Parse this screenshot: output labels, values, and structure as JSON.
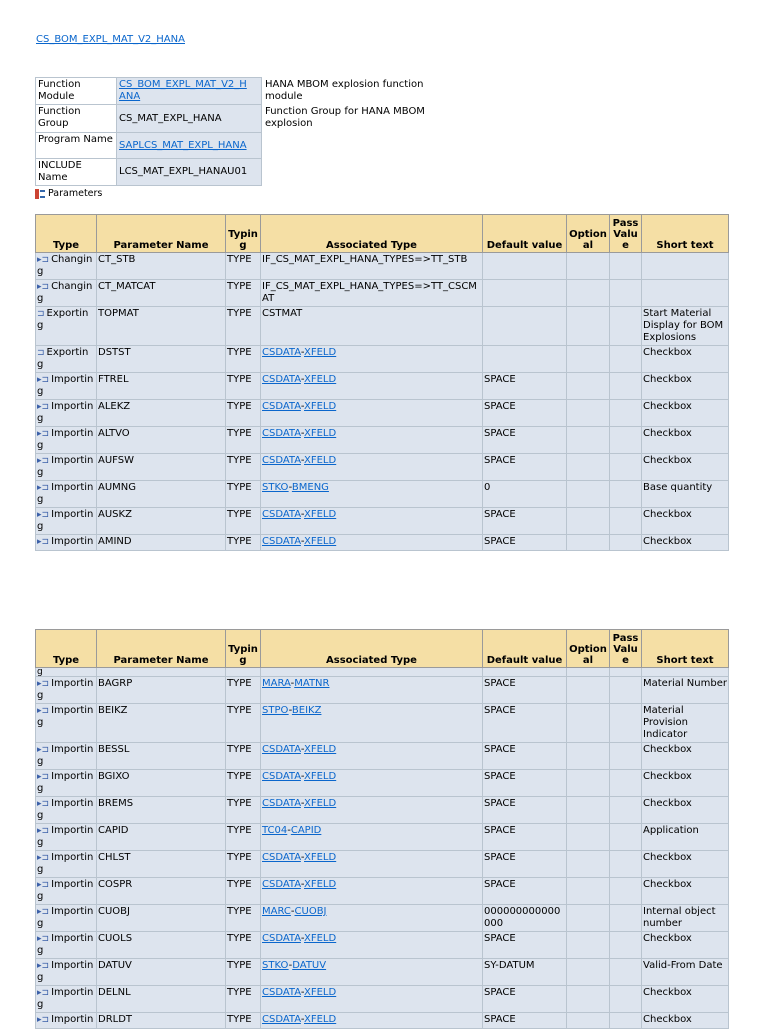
{
  "title_link": "CS_BOM_EXPL_MAT_V2_HANA",
  "info_rows": [
    {
      "label": "Function Module",
      "value": "CS_BOM_EXPL_MAT_V2_HANA",
      "value_display": "CS_BOM_EXPL_MAT_V2_H ANA",
      "link": true,
      "desc": "HANA MBOM explosion function module"
    },
    {
      "label": "Function Group",
      "value": "CS_MAT_EXPL_HANA",
      "value_display": "CS_MAT_EXPL_HANA",
      "link": false,
      "desc": "Function Group for HANA MBOM explosion"
    },
    {
      "label": "Program Name",
      "value": "SAPLCS_MAT_EXPL_HANA",
      "value_display": "SAPLCS_MAT_EXPL_HANA",
      "link": true,
      "desc": ""
    },
    {
      "label": "INCLUDE Name",
      "value": "LCS_MAT_EXPL_HANAU01",
      "value_display": "LCS_MAT_EXPL_HANAU01",
      "link": false,
      "desc": ""
    }
  ],
  "parameters_label": "Parameters",
  "headers": [
    "Type",
    "Parameter Name",
    "Typing",
    "Associated Type",
    "Default value",
    "Optional",
    "Pass Value",
    "Short text"
  ],
  "headers_display": [
    "Type",
    "Parameter Name",
    "Typin g",
    "Associated Type",
    "Default value",
    "Option al",
    "Pass Valu e",
    "Short text"
  ],
  "table1_rows": [
    {
      "type": "Changing",
      "name": "CT_STB",
      "typing": "TYPE",
      "assoc": "IF_CS_MAT_EXPL_HANA_TYPES=>TT_STB",
      "assoc_link": false,
      "default": "",
      "short": ""
    },
    {
      "type": "Changing",
      "name": "CT_MATCAT",
      "typing": "TYPE",
      "assoc": "IF_CS_MAT_EXPL_HANA_TYPES=>TT_CSCMAT",
      "assoc_link": false,
      "default": "",
      "short": ""
    },
    {
      "type": "Exporting",
      "name": "TOPMAT",
      "typing": "TYPE",
      "assoc": "CSTMAT",
      "assoc_link": false,
      "default": "",
      "short": "Start Material Display for BOM Explosions"
    },
    {
      "type": "Exporting",
      "name": "DSTST",
      "typing": "TYPE",
      "assoc_a": "CSDATA",
      "assoc_b": "XFELD",
      "assoc_link": true,
      "default": "",
      "short": "Checkbox"
    },
    {
      "type": "Importing",
      "name": "FTREL",
      "typing": "TYPE",
      "assoc_a": "CSDATA",
      "assoc_b": "XFELD",
      "assoc_link": true,
      "default": "SPACE",
      "short": "Checkbox"
    },
    {
      "type": "Importing",
      "name": "ALEKZ",
      "typing": "TYPE",
      "assoc_a": "CSDATA",
      "assoc_b": "XFELD",
      "assoc_link": true,
      "default": "SPACE",
      "short": "Checkbox"
    },
    {
      "type": "Importing",
      "name": "ALTVO",
      "typing": "TYPE",
      "assoc_a": "CSDATA",
      "assoc_b": "XFELD",
      "assoc_link": true,
      "default": "SPACE",
      "short": "Checkbox"
    },
    {
      "type": "Importing",
      "name": "AUFSW",
      "typing": "TYPE",
      "assoc_a": "CSDATA",
      "assoc_b": "XFELD",
      "assoc_link": true,
      "default": "SPACE",
      "short": "Checkbox"
    },
    {
      "type": "Importing",
      "name": "AUMNG",
      "typing": "TYPE",
      "assoc_a": "STKO",
      "assoc_b": "BMENG",
      "assoc_link": true,
      "default": "0",
      "short": "Base quantity"
    },
    {
      "type": "Importing",
      "name": "AUSKZ",
      "typing": "TYPE",
      "assoc_a": "CSDATA",
      "assoc_b": "XFELD",
      "assoc_link": true,
      "default": "SPACE",
      "short": "Checkbox"
    },
    {
      "type": "Importin",
      "name": "AMIND",
      "typing": "TYPE",
      "assoc_a": "CSDATA",
      "assoc_b": "XFELD",
      "assoc_link": true,
      "default": "SPACE",
      "short": "Checkbox"
    }
  ],
  "table2_stub": "g",
  "table2_rows": [
    {
      "type": "Importing",
      "name": "BAGRP",
      "typing": "TYPE",
      "assoc_a": "MARA",
      "assoc_b": "MATNR",
      "assoc_link": true,
      "default": "SPACE",
      "short": "Material Number"
    },
    {
      "type": "Importing",
      "name": "BEIKZ",
      "typing": "TYPE",
      "assoc_a": "STPO",
      "assoc_b": "BEIKZ",
      "assoc_link": true,
      "default": "SPACE",
      "short": "Material Provision Indicator"
    },
    {
      "type": "Importing",
      "name": "BESSL",
      "typing": "TYPE",
      "assoc_a": "CSDATA",
      "assoc_b": "XFELD",
      "assoc_link": true,
      "default": "SPACE",
      "short": "Checkbox"
    },
    {
      "type": "Importing",
      "name": "BGIXO",
      "typing": "TYPE",
      "assoc_a": "CSDATA",
      "assoc_b": "XFELD",
      "assoc_link": true,
      "default": "SPACE",
      "short": "Checkbox"
    },
    {
      "type": "Importing",
      "name": "BREMS",
      "typing": "TYPE",
      "assoc_a": "CSDATA",
      "assoc_b": "XFELD",
      "assoc_link": true,
      "default": "SPACE",
      "short": "Checkbox"
    },
    {
      "type": "Importing",
      "name": "CAPID",
      "typing": "TYPE",
      "assoc_a": "TC04",
      "assoc_b": "CAPID",
      "assoc_link": true,
      "default": "SPACE",
      "short": "Application"
    },
    {
      "type": "Importing",
      "name": "CHLST",
      "typing": "TYPE",
      "assoc_a": "CSDATA",
      "assoc_b": "XFELD",
      "assoc_link": true,
      "default": "SPACE",
      "short": "Checkbox"
    },
    {
      "type": "Importing",
      "name": "COSPR",
      "typing": "TYPE",
      "assoc_a": "CSDATA",
      "assoc_b": "XFELD",
      "assoc_link": true,
      "default": "SPACE",
      "short": "Checkbox"
    },
    {
      "type": "Importing",
      "name": "CUOBJ",
      "typing": "TYPE",
      "assoc_a": "MARC",
      "assoc_b": "CUOBJ",
      "assoc_link": true,
      "default": "000000000000000",
      "short": "Internal object number"
    },
    {
      "type": "Importing",
      "name": "CUOLS",
      "typing": "TYPE",
      "assoc_a": "CSDATA",
      "assoc_b": "XFELD",
      "assoc_link": true,
      "default": "SPACE",
      "short": "Checkbox"
    },
    {
      "type": "Importing",
      "name": "DATUV",
      "typing": "TYPE",
      "assoc_a": "STKO",
      "assoc_b": "DATUV",
      "assoc_link": true,
      "default": "SY-DATUM",
      "short": "Valid-From Date"
    },
    {
      "type": "Importing",
      "name": "DELNL",
      "typing": "TYPE",
      "assoc_a": "CSDATA",
      "assoc_b": "XFELD",
      "assoc_link": true,
      "default": "SPACE",
      "short": "Checkbox"
    },
    {
      "type": "Importin",
      "name": "DRLDT",
      "typing": "TYPE",
      "assoc_a": "CSDATA",
      "assoc_b": "XFELD",
      "assoc_link": true,
      "default": "SPACE",
      "short": "Checkbox"
    }
  ]
}
